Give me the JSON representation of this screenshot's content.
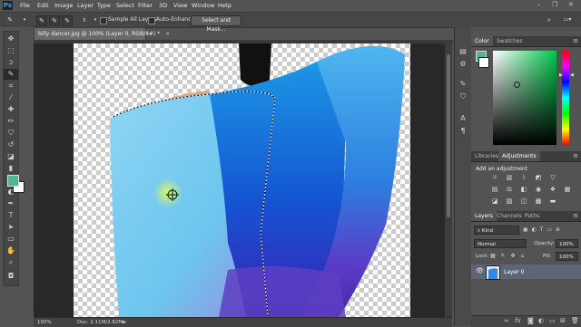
{
  "app": {
    "logo": "Ps"
  },
  "menu": [
    "File",
    "Edit",
    "Image",
    "Layer",
    "Type",
    "Select",
    "Filter",
    "3D",
    "View",
    "Window",
    "Help"
  ],
  "window_controls": [
    "–",
    "❐",
    "✕"
  ],
  "options_bar": {
    "sample_all_layers": "Sample All Layers",
    "auto_enhance": "Auto-Enhance",
    "select_and_mask": "Select and Mask...",
    "brush_size": "5"
  },
  "document": {
    "tab_title": "billy dancer.jpg @ 100% (Layer 0, RGB/8#) *",
    "close_glyph": "×"
  },
  "status": {
    "zoom": "100%",
    "doc_size": "Doc: 2.11M/2.82M",
    "arrow": "▶"
  },
  "color_panel": {
    "tabs": [
      "Color",
      "Swatches"
    ],
    "foreground_color": "#52b495",
    "background_color": "#ffffff"
  },
  "adjustments_panel": {
    "tabs": [
      "Libraries",
      "Adjustments"
    ],
    "title": "Add an adjustment"
  },
  "layers_panel": {
    "tabs": [
      "Layers",
      "Channels",
      "Paths"
    ],
    "filter_kind": "Kind",
    "blend_mode": "Normal",
    "opacity_label": "Opacity:",
    "opacity_value": "100%",
    "lock_label": "Lock:",
    "fill_label": "Fill:",
    "fill_value": "100%",
    "layers": [
      {
        "name": "Layer 0",
        "visible": true
      }
    ],
    "footer_icons": [
      "link-icon",
      "fx-icon",
      "mask-icon",
      "adjustment-layer-icon",
      "group-icon",
      "new-layer-icon",
      "trash-icon"
    ]
  },
  "panel_menu_glyph": "≡",
  "accent_colors": {
    "selection": "#5e6676",
    "fg": "#52b495"
  }
}
